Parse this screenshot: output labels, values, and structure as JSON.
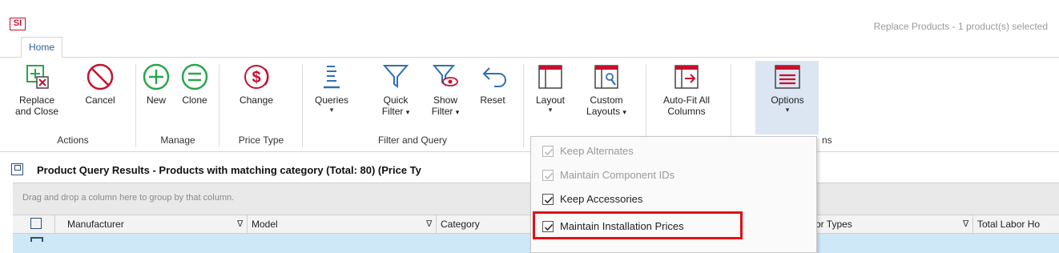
{
  "window": {
    "logo_text": "SI",
    "title": "Replace Products - 1 product(s) selected"
  },
  "tabs": [
    "Home"
  ],
  "ribbon": {
    "buttons": {
      "replace_close": "Replace and Close",
      "replace_close_l1": "Replace",
      "replace_close_l2": "and Close",
      "cancel": "Cancel",
      "new": "New",
      "clone": "Clone",
      "change": "Change",
      "queries": "Queries",
      "quick_filter_l1": "Quick",
      "quick_filter_l2": "Filter",
      "show_filter_l1": "Show",
      "show_filter_l2": "Filter",
      "reset": "Reset",
      "layout": "Layout",
      "custom_layouts_l1": "Custom",
      "custom_layouts_l2": "Layouts",
      "autofit_l1": "Auto-Fit All",
      "autofit_l2": "Columns",
      "options": "Options"
    },
    "groups": {
      "actions": "Actions",
      "manage": "Manage",
      "price_type": "Price Type",
      "filter_query": "Filter and Query",
      "options_partial": "ns"
    },
    "dropdown_glyph": "▾",
    "accent_color": "#c8102e",
    "green_color": "#2aa64a",
    "blue_color": "#2f6fb5"
  },
  "results": {
    "title": "Product Query Results - Products with matching category (Total: 80) (Price Ty",
    "group_hint": "Drag and drop a column here to group by that column.",
    "columns": [
      {
        "label": "Manufacturer",
        "filter": "∇"
      },
      {
        "label": "Model",
        "filter": "∇"
      },
      {
        "label": "Category",
        "filter": "∇"
      },
      {
        "label": "or Types",
        "filter": "∇"
      },
      {
        "label": "Total Labor Ho",
        "filter": ""
      }
    ]
  },
  "options_menu": {
    "items": [
      {
        "label": "Keep Alternates",
        "checked": true,
        "enabled": false
      },
      {
        "label": "Maintain Component IDs",
        "checked": true,
        "enabled": false
      },
      {
        "label": "Keep Accessories",
        "checked": true,
        "enabled": true
      },
      {
        "label": "Maintain Installation Prices",
        "checked": true,
        "enabled": true,
        "highlighted": true
      }
    ],
    "highlight_color": "#e20f15"
  }
}
